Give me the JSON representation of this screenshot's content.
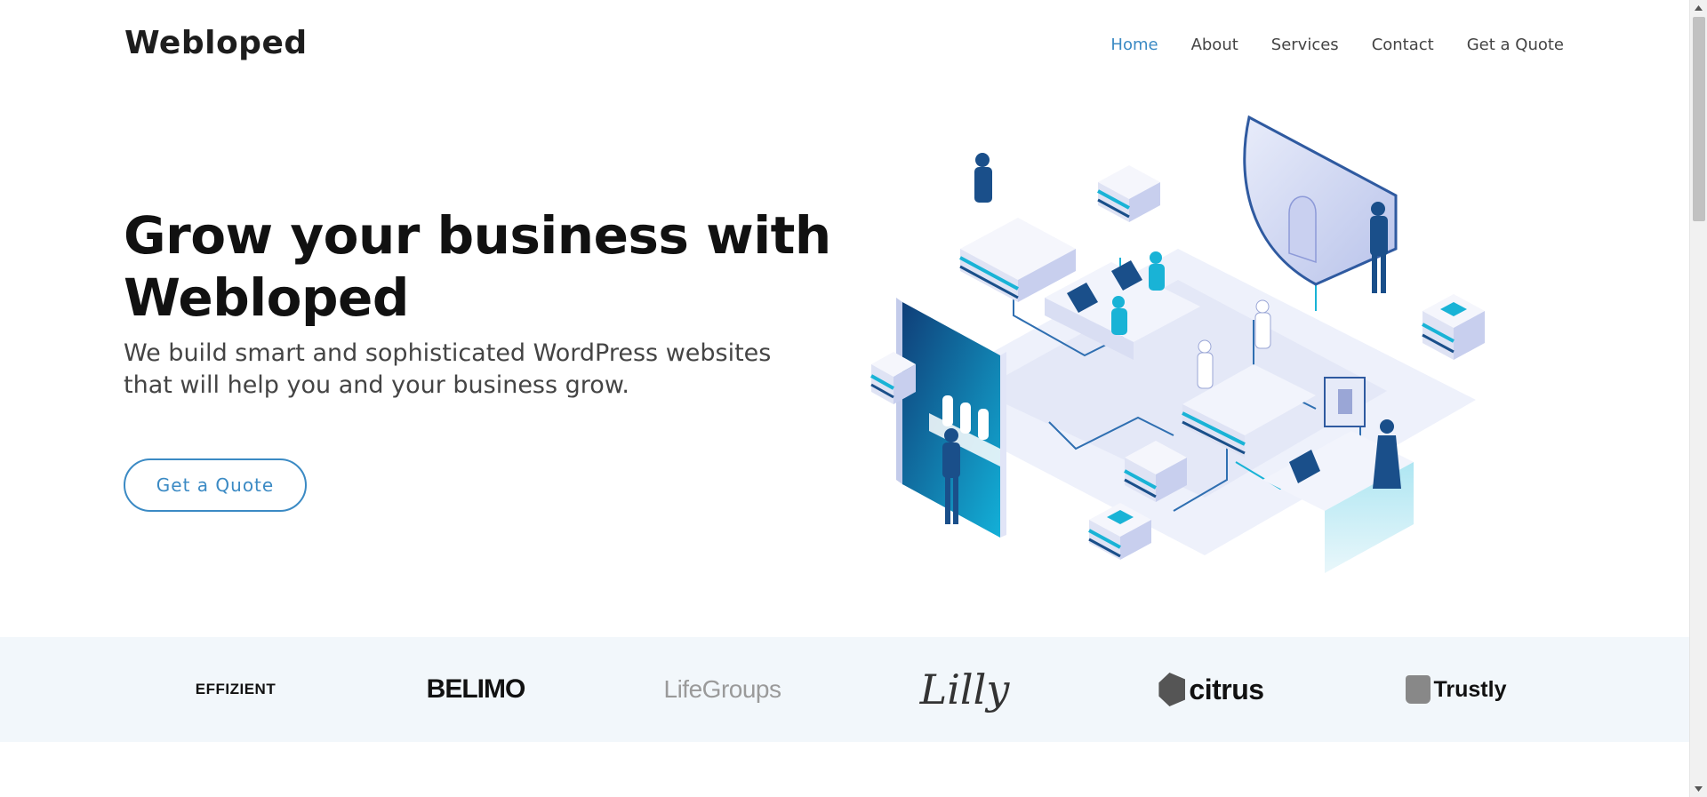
{
  "header": {
    "logo": "Webloped",
    "nav": [
      "Home",
      "About",
      "Services",
      "Contact",
      "Get a Quote"
    ],
    "active_nav": "Home"
  },
  "hero": {
    "title_line1": "Grow your business with",
    "title_line2": "Webloped",
    "subtitle_line1": "We build smart and sophisticated WordPress websites",
    "subtitle_line2": "that will help you and your business grow.",
    "cta": "Get a Quote"
  },
  "clients": {
    "logos": [
      "EFFIZIENT",
      "BELIMO",
      "LifeGroups",
      "Lilly",
      "citrus",
      "Trustly"
    ]
  },
  "colors": {
    "accent": "#3b8ac4",
    "strip_bg": "#f2f7fb",
    "illustration_dark": "#1a4f8a",
    "illustration_cyan": "#19b3d6"
  },
  "icons": {
    "scroll_up": "chevron-up-icon",
    "scroll_down": "chevron-down-icon",
    "illustration": "isometric-office-illustration"
  }
}
